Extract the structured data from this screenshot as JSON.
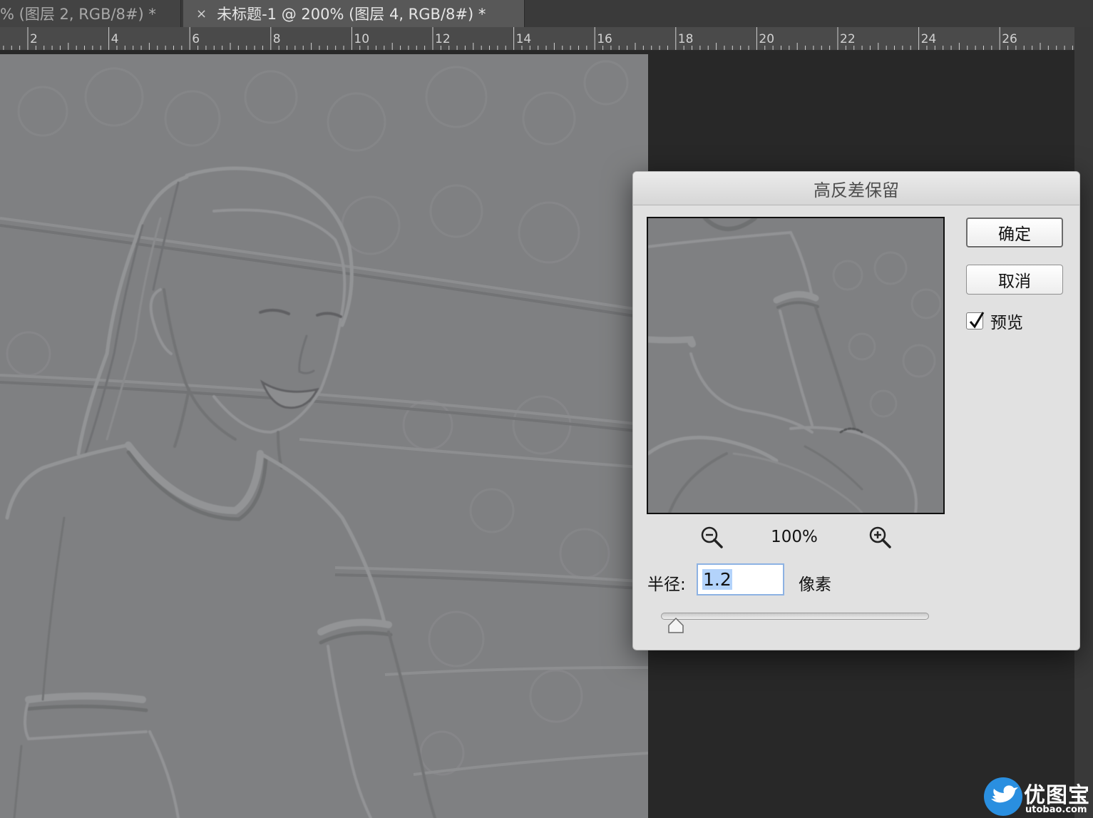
{
  "tabs": [
    {
      "label": "% (图层 2, RGB/8#) *",
      "active": false
    },
    {
      "close": "×",
      "label": "未标题-1 @ 200% (图层 4, RGB/8#) *",
      "active": true
    }
  ],
  "ruler": {
    "labels": [
      "2",
      "4",
      "6",
      "8",
      "10",
      "12",
      "14",
      "16",
      "18",
      "20",
      "22",
      "24",
      "26"
    ]
  },
  "dialog": {
    "title": "高反差保留",
    "ok_label": "确定",
    "cancel_label": "取消",
    "preview_label": "预览",
    "preview_checked": true,
    "zoom_level": "100%",
    "radius_label": "半径:",
    "radius_value": "1.2",
    "unit_label": "像素",
    "slider_fraction": 0.03
  },
  "watermark": {
    "name": "优图宝",
    "url": "utobao.com"
  },
  "icons": {
    "zoom_out": "zoom-out-icon",
    "zoom_in": "zoom-in-icon",
    "check": "checkmark-icon",
    "watermark_logo": "bird-logo-icon"
  }
}
